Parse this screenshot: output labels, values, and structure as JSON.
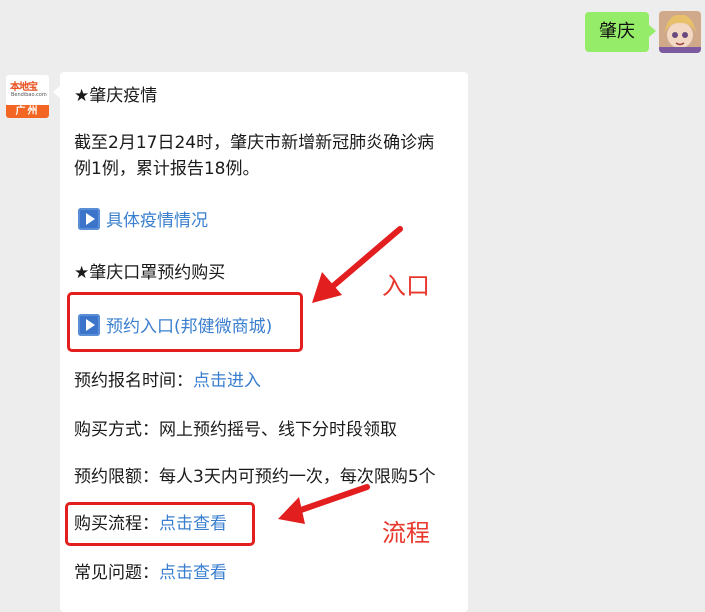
{
  "user_message": "肇庆",
  "bot_avatar": {
    "logo_text": "本地宝",
    "site_text": "Bendibao.com",
    "city": "广州"
  },
  "message": {
    "heading1": "★肇庆疫情",
    "para_line1": "截至2月17日24时，肇庆市新增新冠肺炎确诊病",
    "para_line2": "例1例，累计报告18例。",
    "link1": "具体疫情情况",
    "heading2": "★肇庆口罩预约购买",
    "link2": "预约入口(邦健微商城)",
    "row1_label": "预约报名时间：",
    "row1_link": "点击进入",
    "row2_text": "购买方式：网上预约摇号、线下分时段领取",
    "row3_text": "预约限额：每人3天内可预约一次，每次限购5个",
    "row4_label": "购买流程：",
    "row4_link": "点击查看",
    "row5_label": "常见问题：",
    "row5_link": "点击查看"
  },
  "annotations": {
    "entry": "入口",
    "process": "流程"
  },
  "colors": {
    "user_bubble": "#95ec69",
    "link": "#3a7fcf",
    "annotation_red": "#e21e1e"
  }
}
